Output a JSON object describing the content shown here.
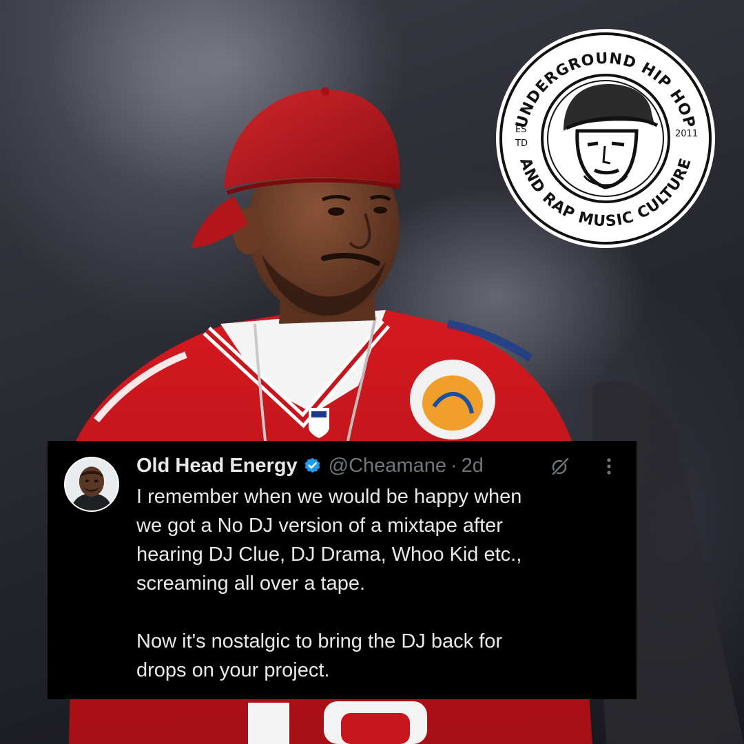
{
  "tweet": {
    "display_name": "Old Head Energy",
    "handle": "@Cheamane",
    "separator": "·",
    "time_ago": "2d",
    "icons": {
      "verified": "verified-badge-icon",
      "grok": "grok-icon",
      "more": "more-options-icon"
    },
    "lines": [
      "I remember when we would be happy when",
      "we got a No DJ version of a mixtape after",
      "hearing DJ Clue, DJ Drama, Whoo Kid etc.,",
      "screaming all over a tape.",
      "",
      "Now it's nostalgic to bring the DJ back for",
      "drops on your project."
    ]
  },
  "emblem": {
    "top_arc": "UNDERGROUND HIP HOP",
    "bottom_arc": "AND RAP MUSIC CULTURE",
    "left_label_1": "ES",
    "left_label_2": "TD",
    "right_label": "2011"
  },
  "colors": {
    "verified": "#1d9bf0",
    "jersey_red": "#c8141c",
    "panel": "#000000",
    "text": "#e7e9ea",
    "muted": "#71767b"
  }
}
